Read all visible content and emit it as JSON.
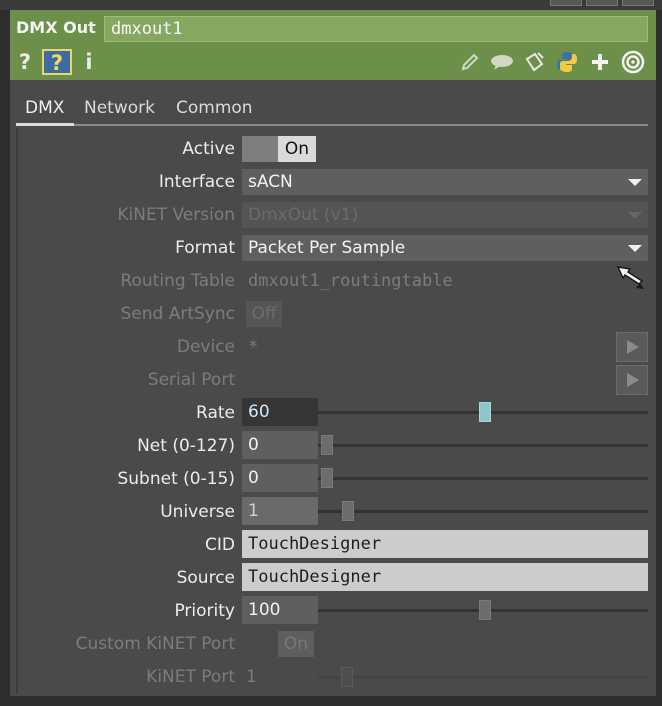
{
  "operator": {
    "type": "DMX Out",
    "name": "dmxout1"
  },
  "header_icons": [
    "help-icon",
    "python-help-icon",
    "info-icon",
    "edit-icon",
    "comment-icon",
    "clone-icon",
    "python-icon",
    "add-icon",
    "target-icon"
  ],
  "help_labels": {
    "help": "?",
    "info": "i"
  },
  "tabs": [
    {
      "label": "DMX"
    },
    {
      "label": "Network"
    },
    {
      "label": "Common"
    }
  ],
  "active_tab": "DMX",
  "params": {
    "active": {
      "label": "Active",
      "value": "On"
    },
    "interface": {
      "label": "Interface",
      "value": "sACN"
    },
    "kinet_version": {
      "label": "KiNET Version",
      "value": "DmxOut (v1)"
    },
    "format": {
      "label": "Format",
      "value": "Packet Per Sample"
    },
    "routing_table": {
      "label": "Routing Table",
      "value": "dmxout1_routingtable"
    },
    "send_artsync": {
      "label": "Send ArtSync",
      "value": "Off"
    },
    "device": {
      "label": "Device",
      "value": "*"
    },
    "serial_port": {
      "label": "Serial Port",
      "value": ""
    },
    "rate": {
      "label": "Rate",
      "value": "60"
    },
    "net": {
      "label": "Net (0-127)",
      "value": "0"
    },
    "subnet": {
      "label": "Subnet (0-15)",
      "value": "0"
    },
    "universe": {
      "label": "Universe",
      "value": "1"
    },
    "cid": {
      "label": "CID",
      "value": "TouchDesigner"
    },
    "source": {
      "label": "Source",
      "value": "TouchDesigner"
    },
    "priority": {
      "label": "Priority",
      "value": "100"
    },
    "custom_kinet_port": {
      "label": "Custom KiNET Port",
      "value": "On"
    },
    "kinet_port": {
      "label": "KiNET Port",
      "value": "1"
    }
  },
  "colors": {
    "header": "#6c8f49",
    "panel": "#4a4a4a",
    "highlight_slider": "#8fc5c9"
  }
}
